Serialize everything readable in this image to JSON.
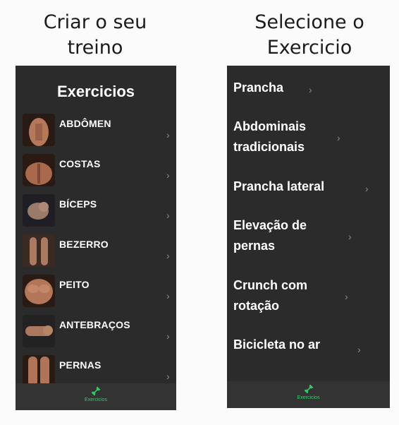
{
  "captions": {
    "left": "Criar o seu\ntreino",
    "right": "Selecione o\nExercicio"
  },
  "left_screen": {
    "title": "Exercicios",
    "categories": [
      {
        "label": "ABDÔMEN"
      },
      {
        "label": "COSTAS"
      },
      {
        "label": "BÍCEPS"
      },
      {
        "label": "BEZERRO"
      },
      {
        "label": "PEITO"
      },
      {
        "label": "ANTEBRAÇOS"
      },
      {
        "label": "PERNAS"
      }
    ],
    "tab": {
      "label": "Exercicios",
      "icon": "dumbbell-icon"
    }
  },
  "right_screen": {
    "exercises": [
      {
        "label": "Prancha"
      },
      {
        "label": "Abdominais\ntradicionais"
      },
      {
        "label": "Prancha lateral"
      },
      {
        "label": "Elevação de\npernas"
      },
      {
        "label": "Crunch com\nrotação"
      },
      {
        "label": "Bicicleta no ar"
      }
    ],
    "tab": {
      "label": "Exercicios",
      "icon": "dumbbell-icon"
    }
  },
  "colors": {
    "screen_bg": "#2b2b2b",
    "tab_bg": "#333333",
    "accent": "#2fd36a",
    "chevron": "#8a8a8a"
  }
}
